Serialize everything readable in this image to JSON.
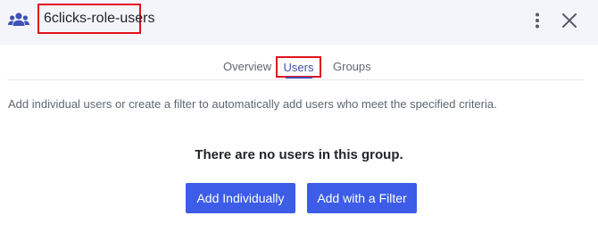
{
  "header": {
    "group_icon": "group-users-icon",
    "title": "6clicks-role-users",
    "menu_icon": "more-vertical-icon",
    "close_icon": "close-icon"
  },
  "tabs": [
    {
      "label": "Overview"
    },
    {
      "label": "Users",
      "active": true
    },
    {
      "label": "Groups"
    }
  ],
  "users_panel": {
    "helper_text": "Add individual users or create a filter to automatically add users who meet the specified criteria.",
    "empty_message": "There are no users in this group.",
    "add_individually_label": "Add Individually",
    "add_with_filter_label": "Add with a Filter"
  },
  "colors": {
    "accent": "#3d5ce8",
    "tab_active": "#3f51b5",
    "highlight_box": "#e3121b",
    "header_bg": "#f4f5fa"
  }
}
